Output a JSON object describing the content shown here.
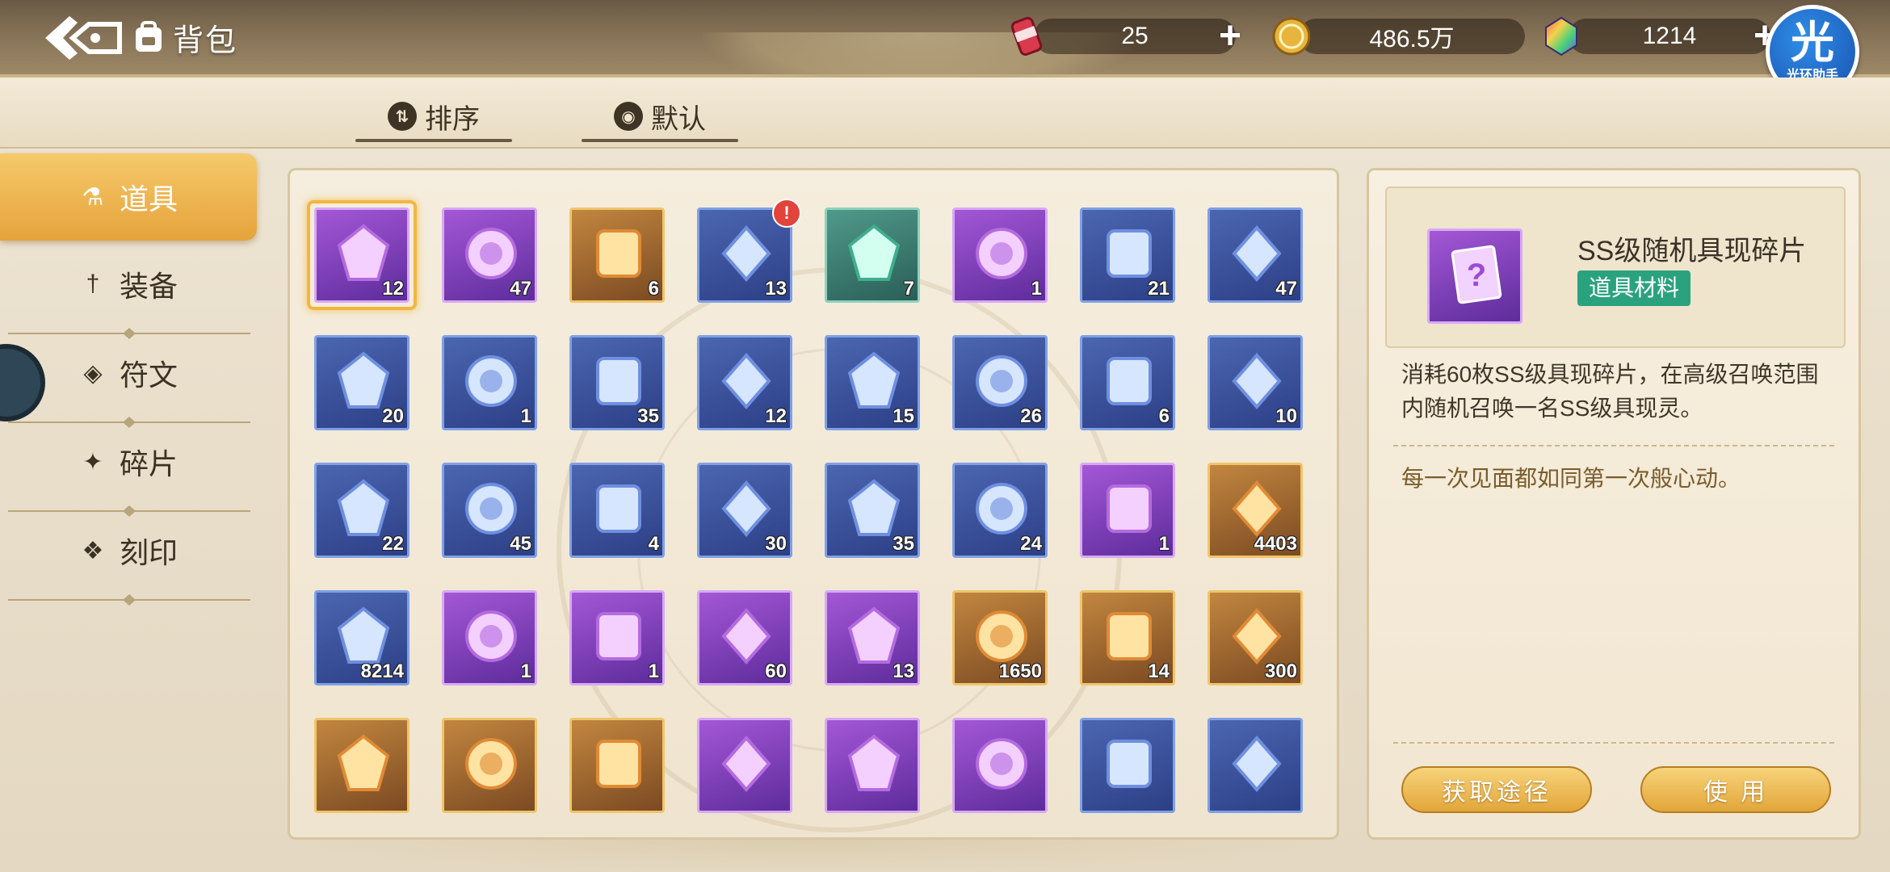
{
  "header": {
    "title": "背包",
    "back_icon": "back-arrow-icon",
    "bag_icon": "backpack-icon"
  },
  "currencies": [
    {
      "name": "stamina-can",
      "icon": "can-icon",
      "value": "25",
      "color": "#d93a4e"
    },
    {
      "name": "gold",
      "icon": "gold-coin-icon",
      "value": "486.5万",
      "color": "#e2b23a"
    },
    {
      "name": "gem",
      "icon": "rainbow-gem-icon",
      "value": "1214",
      "color": "#8b5bd6"
    }
  ],
  "helper": {
    "glyph": "光",
    "label": "光环助手"
  },
  "sort": {
    "sort_label": "排序",
    "default_label": "默认"
  },
  "sidebar": {
    "items": [
      {
        "label": "道具",
        "icon": "flask-icon",
        "active": true
      },
      {
        "label": "装备",
        "icon": "sword-icon",
        "active": false
      },
      {
        "label": "符文",
        "icon": "rune-icon",
        "active": false
      },
      {
        "label": "碎片",
        "icon": "shard-icon",
        "active": false
      },
      {
        "label": "刻印",
        "icon": "seal-icon",
        "active": false
      }
    ]
  },
  "grid": {
    "items": [
      {
        "qty": "12",
        "rarity": "purple",
        "icon": "ss-shard-card-icon",
        "selected": true
      },
      {
        "qty": "47",
        "rarity": "purple",
        "icon": "s-shard-card-icon"
      },
      {
        "qty": "6",
        "rarity": "gold",
        "icon": "mystery-card-icon"
      },
      {
        "qty": "13",
        "rarity": "blue",
        "icon": "heart-gift-box-icon",
        "alert": "!"
      },
      {
        "qty": "7",
        "rarity": "green",
        "icon": "crystal-bowl-icon"
      },
      {
        "qty": "1",
        "rarity": "purple",
        "icon": "robot-pet-icon"
      },
      {
        "qty": "21",
        "rarity": "blue",
        "icon": "green-crystal-icon"
      },
      {
        "qty": "47",
        "rarity": "blue",
        "icon": "gray-stone-icon"
      },
      {
        "qty": "20",
        "rarity": "blue",
        "icon": "leaf-branch-icon"
      },
      {
        "qty": "1",
        "rarity": "blue",
        "icon": "dark-ore-icon"
      },
      {
        "qty": "35",
        "rarity": "blue",
        "icon": "water-bowl-icon"
      },
      {
        "qty": "12",
        "rarity": "blue",
        "icon": "orange-potion-icon"
      },
      {
        "qty": "15",
        "rarity": "blue",
        "icon": "teapot-icon"
      },
      {
        "qty": "26",
        "rarity": "blue",
        "icon": "grain-pile-icon"
      },
      {
        "qty": "6",
        "rarity": "blue",
        "icon": "blue-cloth-icon"
      },
      {
        "qty": "10",
        "rarity": "blue",
        "icon": "golden-apple-icon"
      },
      {
        "qty": "22",
        "rarity": "blue",
        "icon": "umbrella-icon"
      },
      {
        "qty": "45",
        "rarity": "blue",
        "icon": "lighter-icon"
      },
      {
        "qty": "4",
        "rarity": "blue",
        "icon": "open-book-icon"
      },
      {
        "qty": "30",
        "rarity": "blue",
        "icon": "tome-icon"
      },
      {
        "qty": "35",
        "rarity": "blue",
        "icon": "medal-icon"
      },
      {
        "qty": "24",
        "rarity": "blue",
        "icon": "pink-pillow-icon"
      },
      {
        "qty": "1",
        "rarity": "purple",
        "icon": "blue-chip-icon"
      },
      {
        "qty": "4403",
        "rarity": "gold",
        "icon": "diamond-icon"
      },
      {
        "qty": "8214",
        "rarity": "blue",
        "icon": "clear-crystal-icon"
      },
      {
        "qty": "1",
        "rarity": "purple",
        "icon": "diamond-ring-icon"
      },
      {
        "qty": "1",
        "rarity": "purple",
        "icon": "dagger-icon"
      },
      {
        "qty": "60",
        "rarity": "purple",
        "icon": "ice-cube-icon"
      },
      {
        "qty": "13",
        "rarity": "purple",
        "icon": "ticket-card-icon"
      },
      {
        "qty": "1650",
        "rarity": "gold",
        "icon": "blue-pyramid-icon"
      },
      {
        "qty": "14",
        "rarity": "gold",
        "icon": "dynamite-bundle-icon"
      },
      {
        "qty": "300",
        "rarity": "gold",
        "icon": "red-crystal-icon"
      },
      {
        "qty": "",
        "rarity": "gold",
        "icon": "gold-badge-icon"
      },
      {
        "qty": "",
        "rarity": "gold",
        "icon": "pink-ticket-icon"
      },
      {
        "qty": "",
        "rarity": "gold",
        "icon": "arcane-orb-icon"
      },
      {
        "qty": "",
        "rarity": "purple",
        "icon": "red-dynamite-icon"
      },
      {
        "qty": "",
        "rarity": "purple",
        "icon": "golden-key-icon"
      },
      {
        "qty": "",
        "rarity": "purple",
        "icon": "wrench-tools-icon"
      },
      {
        "qty": "",
        "rarity": "blue",
        "icon": "green-swirl-orb-icon"
      },
      {
        "qty": "",
        "rarity": "blue",
        "icon": "blue-swirl-orb-icon"
      }
    ]
  },
  "detail": {
    "name": "SS级随机具现碎片",
    "tag": "道具材料",
    "description": "消耗60枚SS级具现碎片，在高级召唤范围内随机召唤一名SS级具现灵。",
    "flavor": "每一次见面都如同第一次般心动。",
    "obtain_label": "获取途径",
    "use_label": "使 用"
  },
  "colors": {
    "accent_gold": "#e5a33c",
    "tag_green": "#2aa27e",
    "alert_red": "#e2433b"
  }
}
